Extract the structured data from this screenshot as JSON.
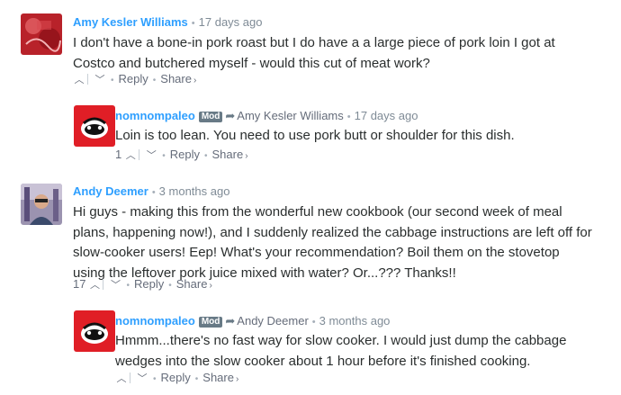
{
  "comments": [
    {
      "author": "Amy Kesler Williams",
      "time": "17 days ago",
      "text": "I don't have a bone-in pork roast but I do have a a large piece of pork loin I got at Costco and butchered myself - would this cut of meat work?",
      "votes": "",
      "reply_label": "Reply",
      "share_label": "Share",
      "avatar_color": "#c0282e"
    },
    {
      "author": "nomnompaleo",
      "badge": "Mod",
      "parent_author": "Amy Kesler Williams",
      "time": "17 days ago",
      "text": "Loin is too lean. You need to use pork butt or shoulder for this dish.",
      "votes": "1",
      "reply_label": "Reply",
      "share_label": "Share",
      "avatar_color": "#e01e26"
    },
    {
      "author": "Andy Deemer",
      "time": "3 months ago",
      "text": "Hi guys - making this from the wonderful new cookbook (our second week of meal plans, happening now!), and I suddenly realized the cabbage instructions are left off for slow-cooker users! Eep! What's your recommendation? Boil them on the stovetop using the leftover pork juice mixed with water? Or...??? Thanks!!",
      "votes": "17",
      "reply_label": "Reply",
      "share_label": "Share",
      "avatar_color": "#7a6f8c"
    },
    {
      "author": "nomnompaleo",
      "badge": "Mod",
      "parent_author": "Andy Deemer",
      "time": "3 months ago",
      "text": "Hmmm...there's no fast way for slow cooker. I would just dump the cabbage wedges into the slow cooker about 1 hour before it's finished cooking.",
      "votes": "",
      "reply_label": "Reply",
      "share_label": "Share",
      "avatar_color": "#e01e26"
    }
  ],
  "colors": {
    "author": "#2e9fff",
    "text": "#2a2e2e",
    "meta": "#7f8b96",
    "badge": "#687a86"
  },
  "icons": {
    "upvote": "chevron-up-icon",
    "downvote": "chevron-down-icon",
    "reply_to": "reply-arrow-icon",
    "share": "chevron-right-icon"
  }
}
